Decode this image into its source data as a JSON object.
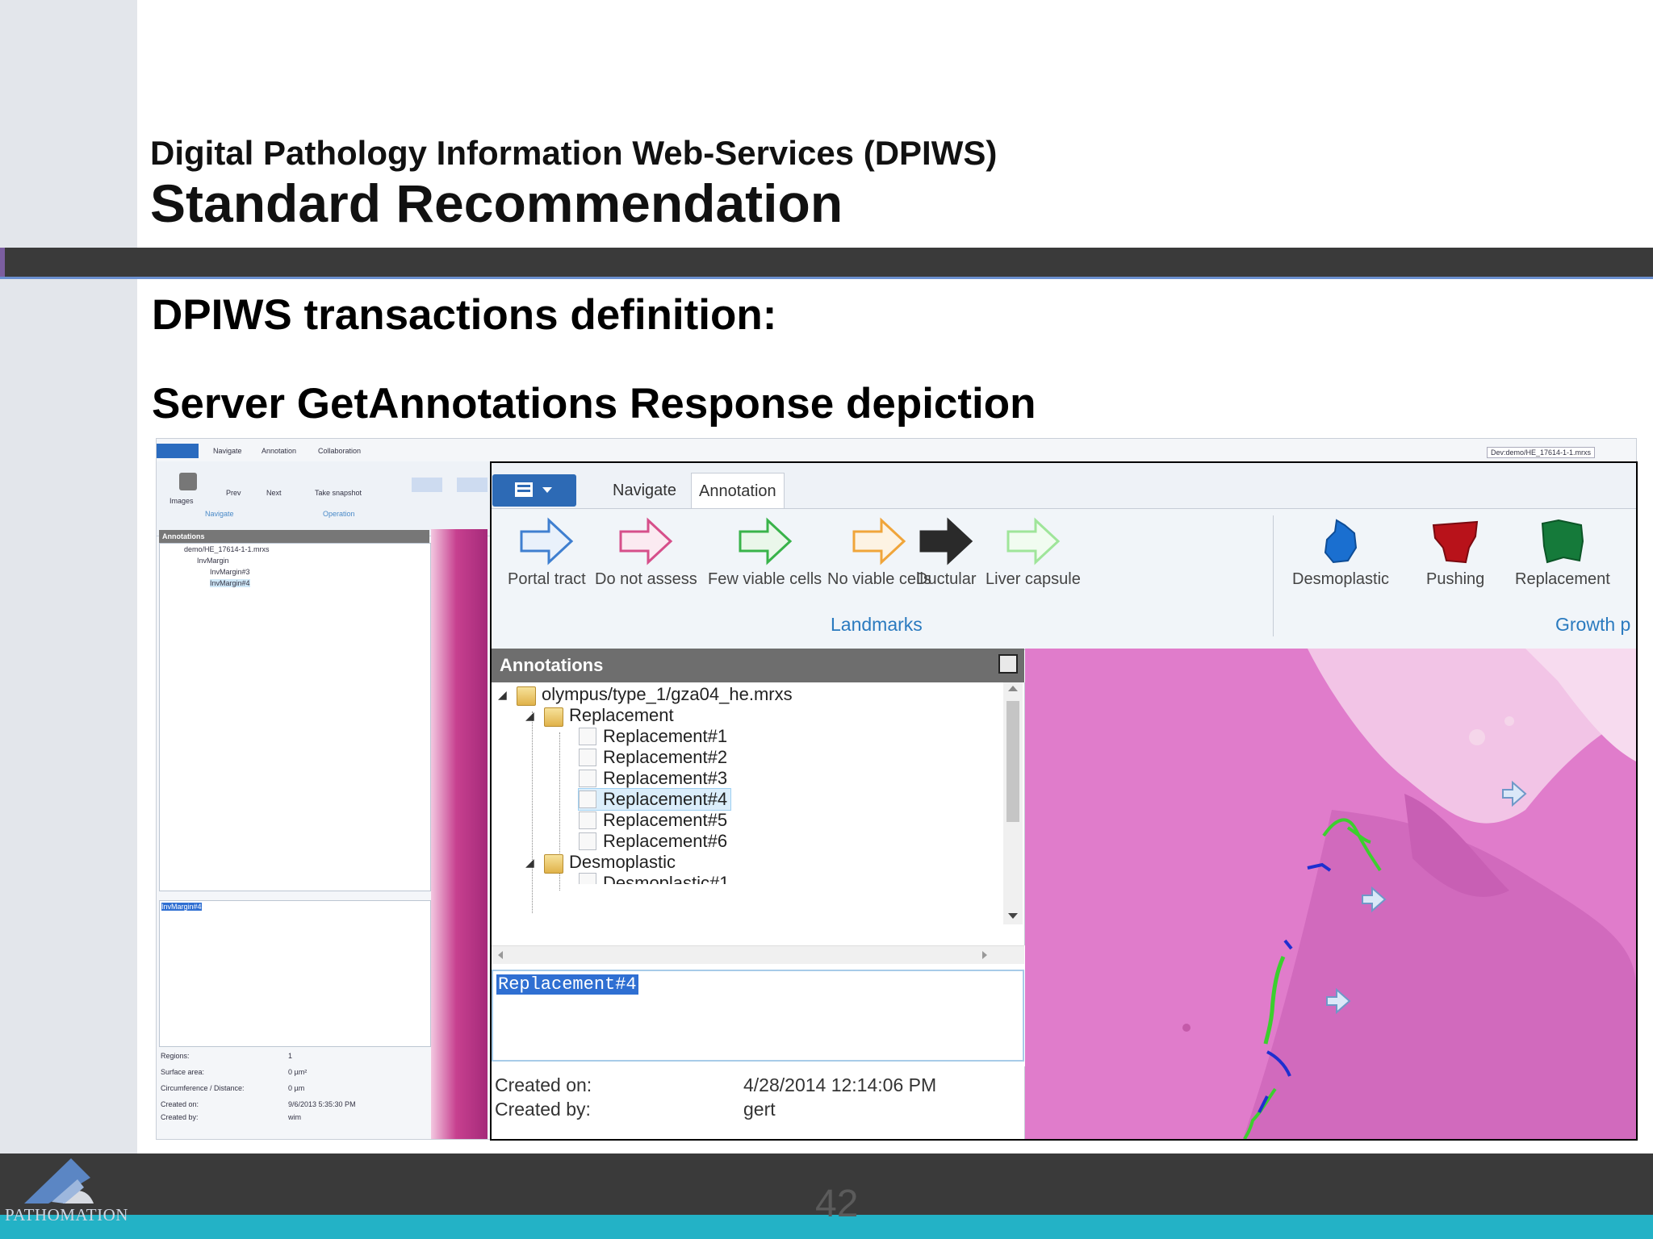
{
  "slide": {
    "subtitle": "Digital Pathology Information Web-Services (DPIWS)",
    "title": "Standard Recommendation",
    "heading1": "DPIWS transactions definition:",
    "heading2": "Server GetAnnotations Response depiction",
    "page_number": "42",
    "logo_text": "PATHOMATION"
  },
  "app": {
    "tabs": [
      {
        "label": "Navigate"
      },
      {
        "label": "Annotation"
      }
    ],
    "tools": [
      {
        "label": "Portal tract",
        "icon": "arrow-icon",
        "color": "#3f7fd0"
      },
      {
        "label": "Do not assess",
        "icon": "arrow-icon",
        "color": "#d64f8a"
      },
      {
        "label": "Few viable cells",
        "icon": "arrow-icon",
        "color": "#39b34a"
      },
      {
        "label": "No viable cells",
        "icon": "arrow-icon",
        "color": "#f0a53a"
      },
      {
        "label": "Ductular",
        "icon": "arrow-icon",
        "color": "#2a2a2a"
      },
      {
        "label": "Liver capsule",
        "icon": "arrow-icon",
        "color": "#9fe59a"
      },
      {
        "label": "Desmoplastic",
        "icon": "region-icon",
        "color": "#1a6fd0"
      },
      {
        "label": "Pushing",
        "icon": "region-icon",
        "color": "#b8121a"
      },
      {
        "label": "Replacement",
        "icon": "region-icon",
        "color": "#157a3a"
      }
    ],
    "groups": {
      "landmarks": "Landmarks",
      "growth": "Growth p"
    },
    "annotations_panel": {
      "title": "Annotations",
      "root": "olympus/type_1/gza04_he.mrxs",
      "folder1": "Replacement",
      "items": [
        "Replacement#1",
        "Replacement#2",
        "Replacement#3",
        "Replacement#4",
        "Replacement#5",
        "Replacement#6"
      ],
      "selected_index": 3,
      "folder2": "Desmoplastic",
      "partial_item": "Desmoplastic#1"
    },
    "description": "Replacement#4",
    "meta": {
      "created_on_label": "Created on:",
      "created_on_value": "4/28/2014 12:14:06 PM",
      "created_by_label": "Created by:",
      "created_by_value": "gert"
    }
  },
  "background_app": {
    "tabs": [
      "Navigate",
      "Annotation",
      "Collaboration"
    ],
    "buttons": [
      "Images",
      "Prev",
      "Next",
      "Take snapshot"
    ],
    "groups": [
      "Navigate",
      "Operation"
    ],
    "path_box": "Dev:demo/HE_17614-1-1.mrxs",
    "annotations_title": "Annotations",
    "tree": [
      "demo/HE_17614-1-1.mrxs",
      "InvMargin",
      "InvMargin#3",
      "InvMargin#4"
    ],
    "desc": "InvMargin#4",
    "info_labels": [
      "Regions:",
      "Surface area:",
      "Circumference / Distance:",
      "Created on:",
      "Created by:"
    ],
    "info_values": [
      "1",
      "0 µm²",
      "0 µm",
      "9/6/2013 5:35:30 PM",
      "wim"
    ]
  },
  "colors": {
    "header_bar": "#3a3a3a",
    "footer_teal": "#23b2c6",
    "accent_blue": "#2d6ab5",
    "tissue_pink": "#e58ad0"
  }
}
